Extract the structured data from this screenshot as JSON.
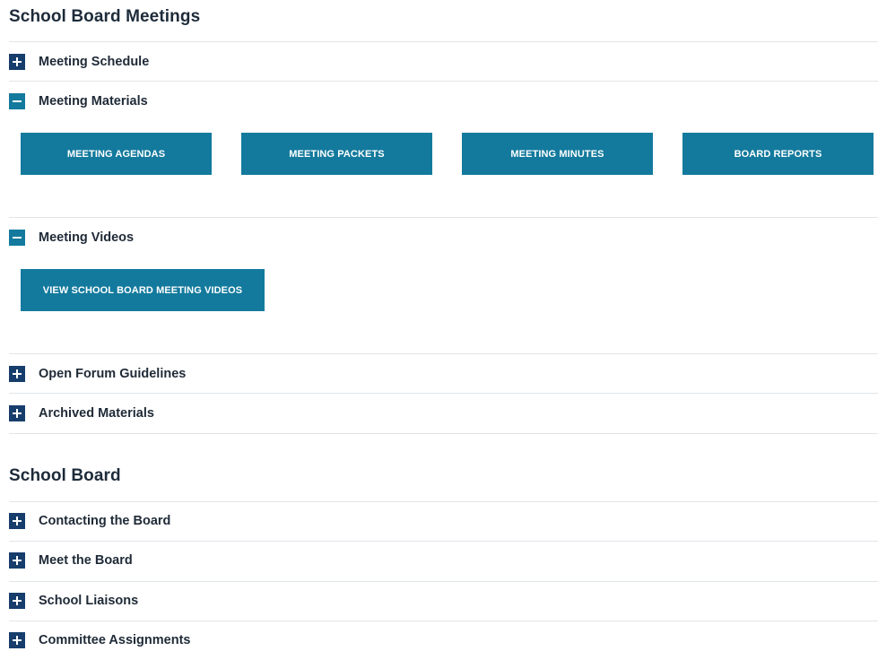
{
  "sections": [
    {
      "title": "School Board Meetings",
      "items": [
        {
          "label": "Meeting Schedule",
          "state": "collapsed",
          "icon": "plus-icon"
        },
        {
          "label": "Meeting Materials",
          "state": "expanded",
          "icon": "minus-icon",
          "buttons": [
            "MEETING AGENDAS",
            "MEETING PACKETS",
            "MEETING MINUTES",
            "BOARD REPORTS"
          ]
        },
        {
          "label": "Meeting Videos",
          "state": "expanded",
          "icon": "minus-icon",
          "buttons": [
            "VIEW SCHOOL BOARD MEETING VIDEOS"
          ]
        },
        {
          "label": "Open Forum Guidelines",
          "state": "collapsed",
          "icon": "plus-icon"
        },
        {
          "label": "Archived Materials",
          "state": "collapsed",
          "icon": "plus-icon"
        }
      ]
    },
    {
      "title": "School Board",
      "items": [
        {
          "label": "Contacting the Board",
          "state": "collapsed",
          "icon": "plus-icon"
        },
        {
          "label": "Meet the Board",
          "state": "collapsed",
          "icon": "plus-icon"
        },
        {
          "label": "School Liaisons",
          "state": "collapsed",
          "icon": "plus-icon"
        },
        {
          "label": "Committee Assignments",
          "state": "collapsed",
          "icon": "plus-icon"
        }
      ]
    }
  ],
  "colors": {
    "collapsed_toggle": "#163d6b",
    "expanded_toggle": "#137a9d",
    "button_bg": "#137a9d",
    "divider": "#e2e5e8"
  }
}
